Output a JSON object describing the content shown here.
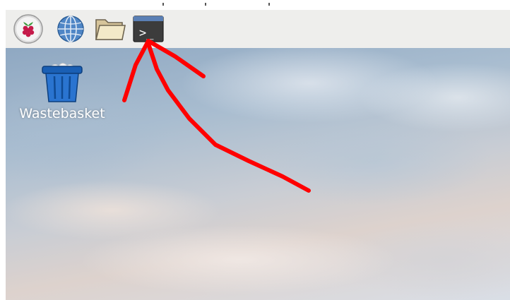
{
  "taskbar": {
    "launchers": [
      {
        "icon": "raspberry-menu-icon"
      },
      {
        "icon": "web-browser-globe-icon"
      },
      {
        "icon": "file-manager-folder-icon"
      },
      {
        "icon": "terminal-icon",
        "glyph": ">_"
      }
    ]
  },
  "desktop": {
    "icons": [
      {
        "icon": "wastebasket-icon",
        "label": "Wastebasket"
      }
    ]
  },
  "annotation": {
    "type": "hand-drawn-arrow",
    "color": "#ff0000",
    "points_to": "terminal-icon"
  },
  "colors": {
    "taskbar_bg": "#eeeeec",
    "terminal_title": "#5a7fb5",
    "terminal_body": "#3c3c3c",
    "trash_blue": "#1a5fb4",
    "annotation_red": "#ff0000"
  }
}
